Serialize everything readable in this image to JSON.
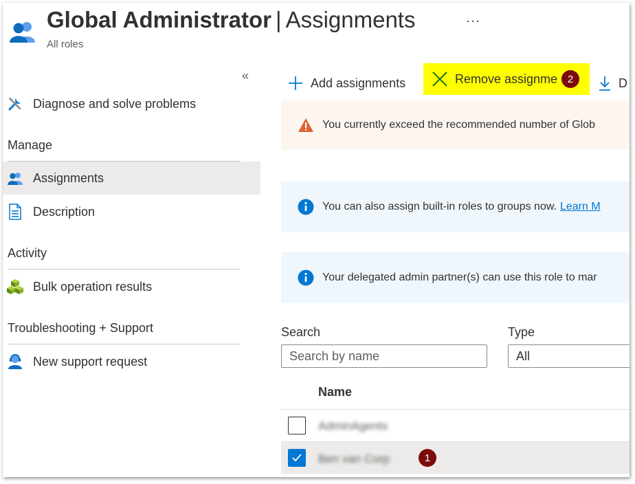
{
  "header": {
    "title_bold": "Global Administrator",
    "title_separator": "|",
    "title_light": "Assignments",
    "more": "···",
    "breadcrumb": "All roles"
  },
  "sidebar": {
    "collapse": "«",
    "diagnose": "Diagnose and solve problems",
    "manage_heading": "Manage",
    "assignments": "Assignments",
    "description": "Description",
    "activity_heading": "Activity",
    "bulk": "Bulk operation results",
    "troubleshoot_heading": "Troubleshooting + Support",
    "support": "New support request"
  },
  "toolbar": {
    "add": "Add assignments",
    "remove": "Remove assignme",
    "download": "D"
  },
  "annotations": {
    "one": "1",
    "two": "2"
  },
  "banners": {
    "warning": "You currently exceed the recommended number of Glob",
    "info1": "You can also assign built-in roles to groups now.",
    "info1_link": "Learn M",
    "info2": "Your delegated admin partner(s) can use this role to mar"
  },
  "filters": {
    "search_label": "Search",
    "search_placeholder": "Search by name",
    "type_label": "Type",
    "type_value": "All"
  },
  "table": {
    "name_header": "Name",
    "rows": [
      {
        "name": "AdminAgents",
        "checked": false
      },
      {
        "name": "Ben van Corp",
        "checked": true
      }
    ]
  },
  "colors": {
    "accent": "#0078d4",
    "highlight": "#ffff00",
    "badge": "#7b0c0c",
    "warning": "#d9652f",
    "selected_bg": "#edebe9"
  }
}
